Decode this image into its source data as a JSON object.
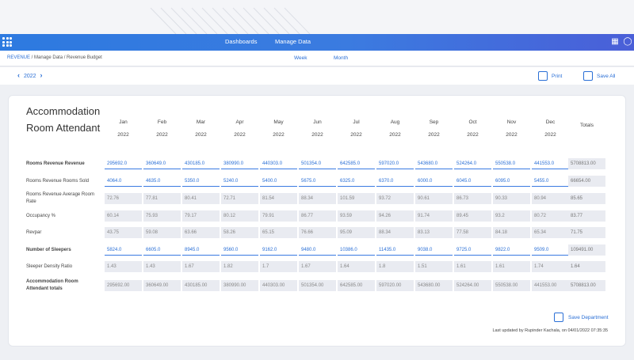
{
  "nav": {
    "links": [
      "Dashboards",
      "Manage Data"
    ]
  },
  "breadcrumb": {
    "root": "REVENUE",
    "rest": " / Manage Data / Revenue Budget"
  },
  "modes": [
    "Week",
    "Month"
  ],
  "year": "2022",
  "toolbar": {
    "print": "Print",
    "save_all": "Save All"
  },
  "title": "Accommodation Room Attendant",
  "months": [
    "Jan",
    "Feb",
    "Mar",
    "Apr",
    "May",
    "Jun",
    "Jul",
    "Aug",
    "Sep",
    "Oct",
    "Nov",
    "Dec"
  ],
  "month_year": "2022",
  "totals_header": "Totals",
  "rows": [
    {
      "label": "Rooms Revenue Revenue",
      "bold": true,
      "editable": true,
      "values": [
        "295692.0",
        "360649.0",
        "430185.0",
        "380990.0",
        "440303.0",
        "501354.0",
        "642585.0",
        "597020.0",
        "543680.0",
        "524264.0",
        "550538.0",
        "441553.0"
      ],
      "total": "5708813.00"
    },
    {
      "label": "Rooms Revenue Rooms Sold",
      "bold": false,
      "editable": true,
      "values": [
        "4064.0",
        "4635.0",
        "5350.0",
        "5240.0",
        "5400.0",
        "5675.0",
        "6325.0",
        "6370.0",
        "6000.0",
        "6045.0",
        "6095.0",
        "5455.0"
      ],
      "total": "66654.00"
    },
    {
      "label": "Rooms Revenue Average Room Rate",
      "bold": false,
      "editable": false,
      "values": [
        "72.76",
        "77.81",
        "80.41",
        "72.71",
        "81.54",
        "88.34",
        "101.59",
        "93.72",
        "90.61",
        "86.73",
        "90.33",
        "80.94"
      ],
      "total": "85.65"
    },
    {
      "label": "Occupancy %",
      "bold": false,
      "editable": false,
      "values": [
        "60.14",
        "75.93",
        "79.17",
        "80.12",
        "79.91",
        "86.77",
        "93.59",
        "94.26",
        "91.74",
        "89.45",
        "93.2",
        "80.72"
      ],
      "total": "83.77"
    },
    {
      "label": "Revpar",
      "bold": false,
      "editable": false,
      "values": [
        "43.75",
        "59.08",
        "63.66",
        "58.26",
        "65.15",
        "76.66",
        "95.09",
        "88.34",
        "83.13",
        "77.58",
        "84.18",
        "65.34"
      ],
      "total": "71.75"
    },
    {
      "label": "Number of Sleepers",
      "bold": true,
      "editable": true,
      "values": [
        "5824.0",
        "6605.0",
        "8945.0",
        "9560.0",
        "9162.0",
        "9480.0",
        "10386.0",
        "11435.0",
        "9038.0",
        "9725.0",
        "9822.0",
        "9509.0"
      ],
      "total": "109491.00"
    },
    {
      "label": "Sleeper Density Ratio",
      "bold": false,
      "editable": false,
      "values": [
        "1.43",
        "1.43",
        "1.67",
        "1.82",
        "1.7",
        "1.67",
        "1.64",
        "1.8",
        "1.51",
        "1.61",
        "1.61",
        "1.74"
      ],
      "total": "1.64"
    },
    {
      "label": "Accommodation Room Attendant totals",
      "bold": true,
      "editable": false,
      "values": [
        "295692.00",
        "360649.00",
        "430185.00",
        "380990.00",
        "440303.00",
        "501354.00",
        "642585.00",
        "597020.00",
        "543680.00",
        "524264.00",
        "550538.00",
        "441553.00"
      ],
      "total": "5708813.00"
    }
  ],
  "save_department": "Save Department",
  "last_updated": "Last updated by Rupinder Kachala, on 04/01/2022 07:35:35"
}
